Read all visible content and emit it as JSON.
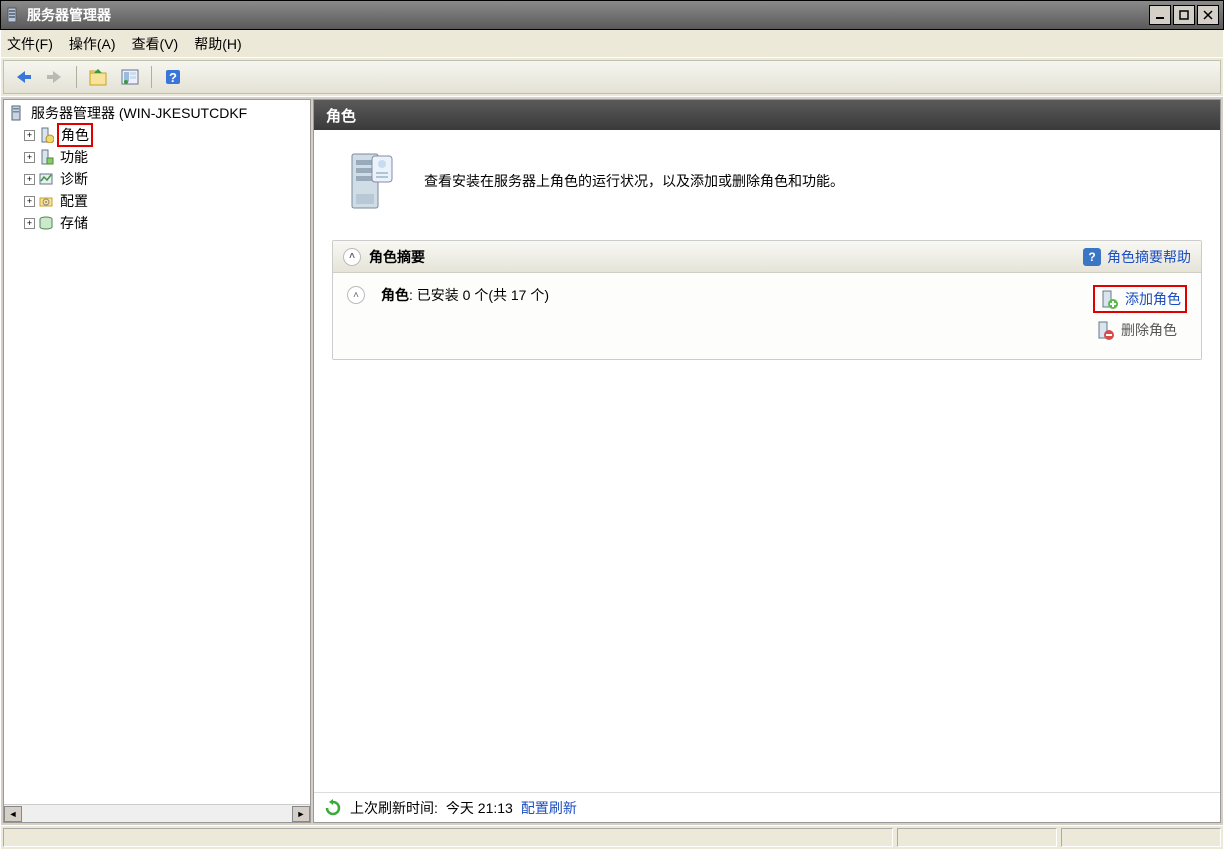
{
  "window": {
    "title": "服务器管理器"
  },
  "menu": {
    "file": "文件(F)",
    "action": "操作(A)",
    "view": "查看(V)",
    "help": "帮助(H)"
  },
  "tree": {
    "root": "服务器管理器 (WIN-JKESUTCDKF",
    "items": [
      {
        "label": "角色",
        "highlighted": true
      },
      {
        "label": "功能"
      },
      {
        "label": "诊断"
      },
      {
        "label": "配置"
      },
      {
        "label": "存储"
      }
    ]
  },
  "content": {
    "header": "角色",
    "intro": "查看安装在服务器上角色的运行状况，以及添加或删除角色和功能。",
    "section_title": "角色摘要",
    "help_link": "角色摘要帮助",
    "roles_label": "角色",
    "roles_status": "已安装 0 个(共 17 个)",
    "add_role": "添加角色",
    "remove_role": "删除角色"
  },
  "status": {
    "last_refresh_label": "上次刷新时间:",
    "last_refresh_value": "今天 21:13",
    "configure_refresh": "配置刷新"
  }
}
